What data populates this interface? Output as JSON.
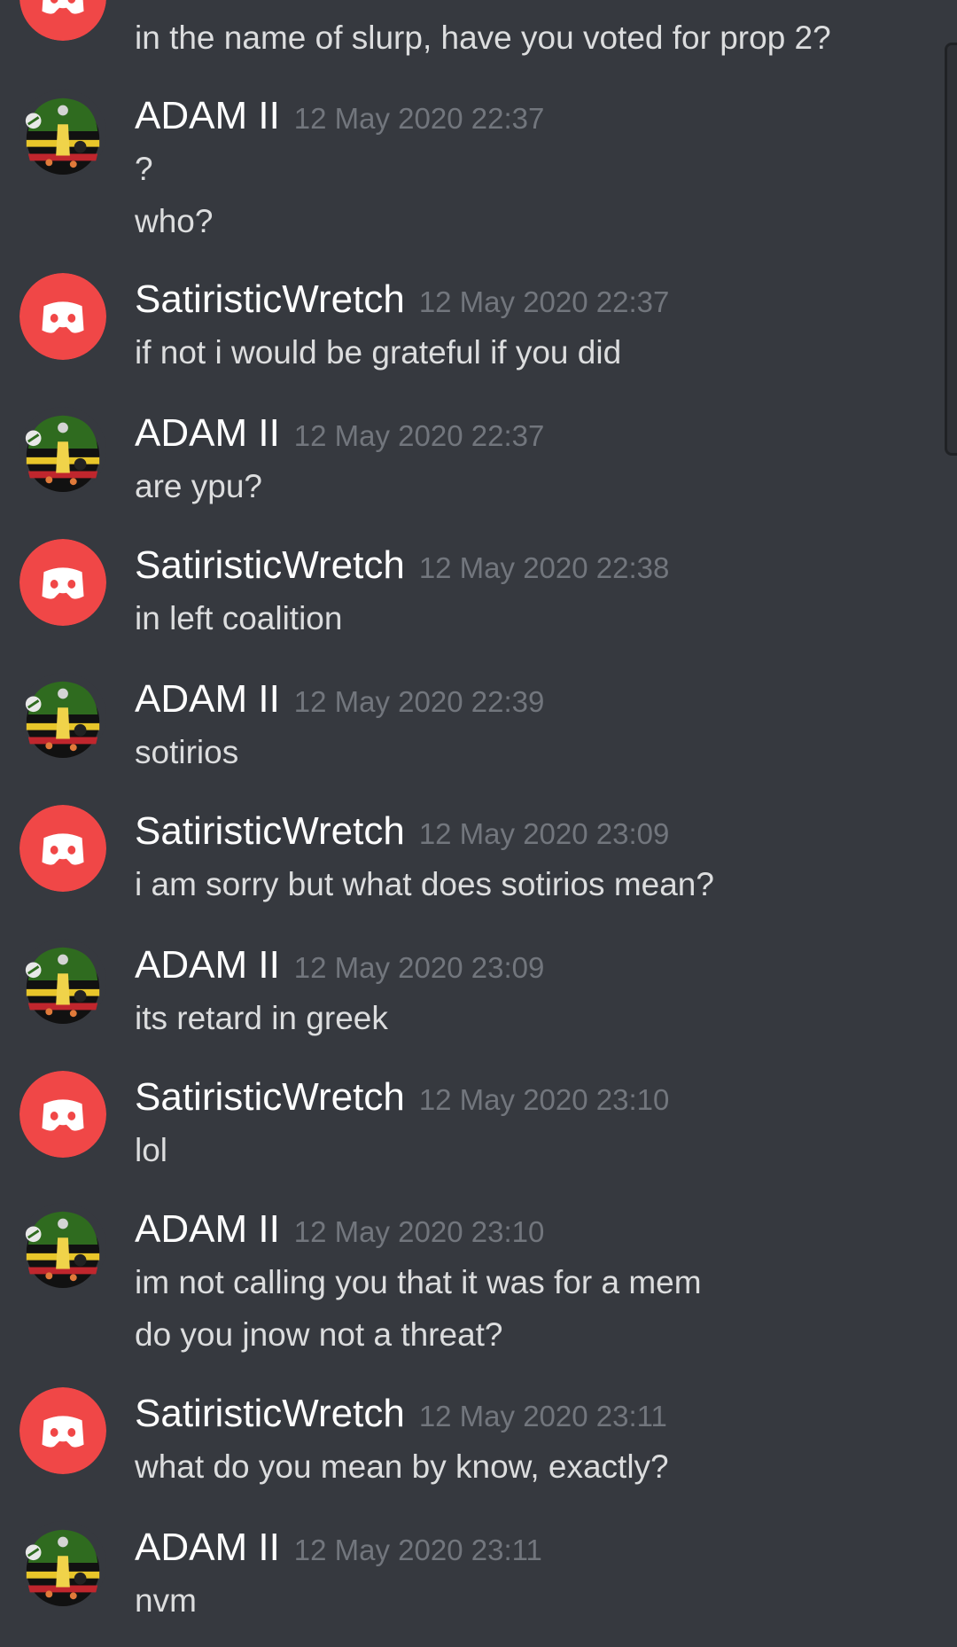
{
  "colors": {
    "background": "#36393f",
    "username": "#ffffff",
    "timestamp": "#72767d",
    "message": "#dcddde",
    "discord_red": "#f04747"
  },
  "top_partial": {
    "text": "in the name of slurp, have you voted for prop 2?",
    "avatar": "discord-default-avatar-icon"
  },
  "messages": [
    {
      "author": "ADAM II",
      "timestamp": "12 May 2020 22:37",
      "lines": [
        "?",
        "who?"
      ],
      "avatar": "military-ball-avatar-icon"
    },
    {
      "author": "SatiristicWretch",
      "timestamp": "12 May 2020 22:37",
      "lines": [
        "if not i would be grateful if you did"
      ],
      "avatar": "discord-default-avatar-icon"
    },
    {
      "author": "ADAM II",
      "timestamp": "12 May 2020 22:37",
      "lines": [
        "are ypu?"
      ],
      "avatar": "military-ball-avatar-icon"
    },
    {
      "author": "SatiristicWretch",
      "timestamp": "12 May 2020 22:38",
      "lines": [
        "in left coalition"
      ],
      "avatar": "discord-default-avatar-icon"
    },
    {
      "author": "ADAM II",
      "timestamp": "12 May 2020 22:39",
      "lines": [
        "sotirios"
      ],
      "avatar": "military-ball-avatar-icon"
    },
    {
      "author": "SatiristicWretch",
      "timestamp": "12 May 2020 23:09",
      "lines": [
        "i am sorry but what does sotirios mean?"
      ],
      "avatar": "discord-default-avatar-icon"
    },
    {
      "author": "ADAM II",
      "timestamp": "12 May 2020 23:09",
      "lines": [
        "its retard in greek"
      ],
      "avatar": "military-ball-avatar-icon"
    },
    {
      "author": "SatiristicWretch",
      "timestamp": "12 May 2020 23:10",
      "lines": [
        "lol"
      ],
      "avatar": "discord-default-avatar-icon"
    },
    {
      "author": "ADAM II",
      "timestamp": "12 May 2020 23:10",
      "lines": [
        "im not calling you that it was for a mem",
        "do you jnow not a threat?"
      ],
      "avatar": "military-ball-avatar-icon"
    },
    {
      "author": "SatiristicWretch",
      "timestamp": "12 May 2020 23:11",
      "lines": [
        "what do you mean by know, exactly?"
      ],
      "avatar": "discord-default-avatar-icon"
    },
    {
      "author": "ADAM II",
      "timestamp": "12 May 2020 23:11",
      "lines": [
        "nvm"
      ],
      "avatar": "military-ball-avatar-icon"
    }
  ]
}
